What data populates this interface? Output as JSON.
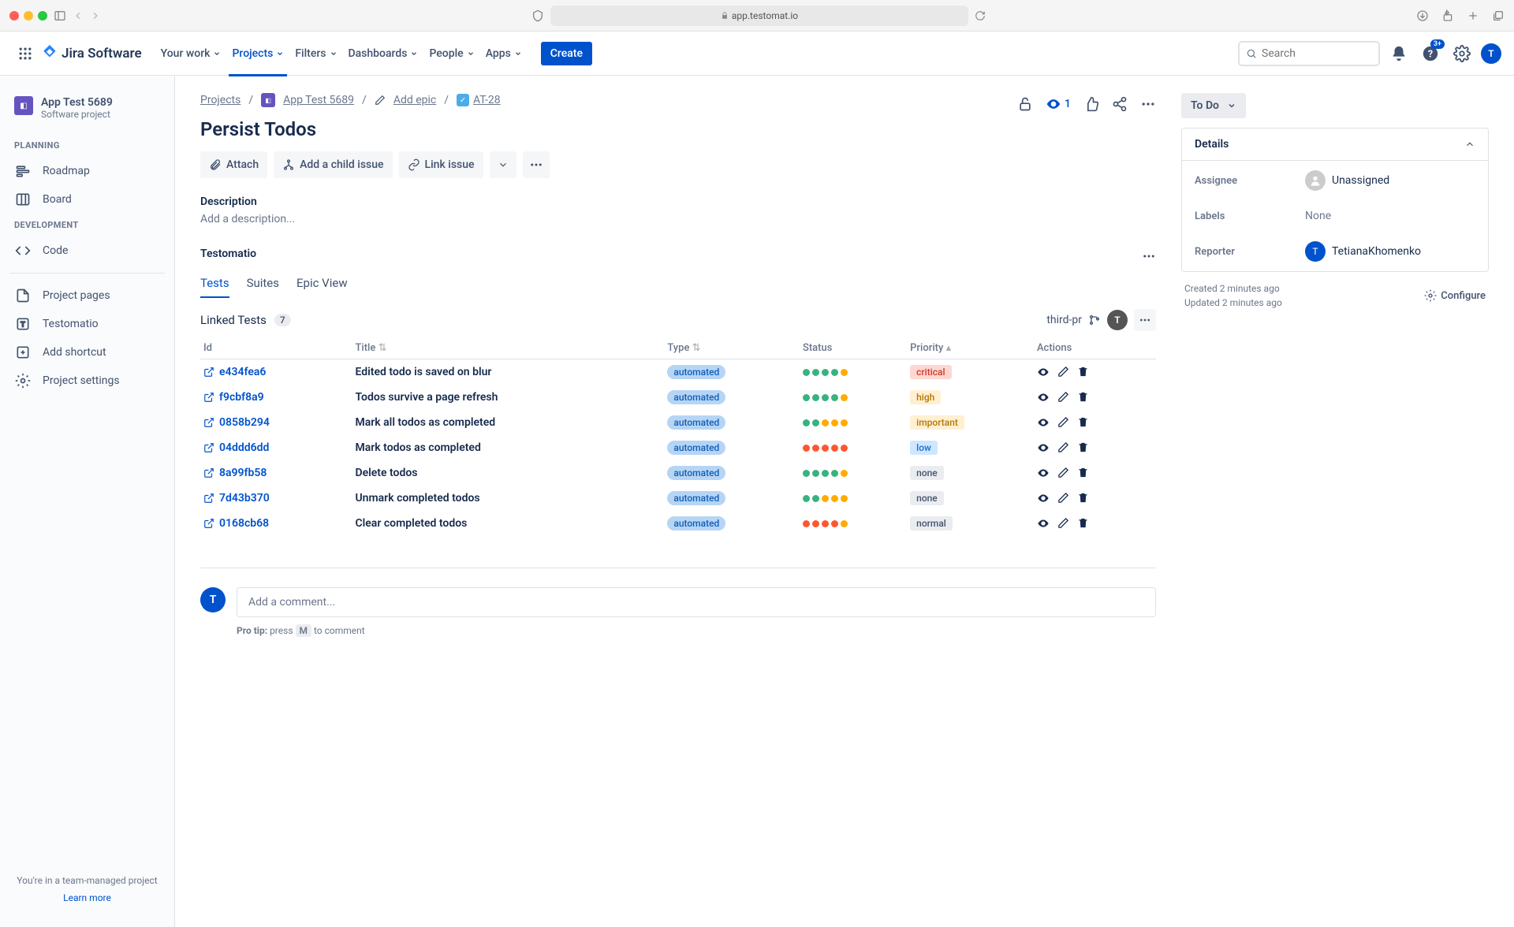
{
  "browser": {
    "url": "app.testomat.io"
  },
  "topnav": {
    "logo": "Jira Software",
    "items": [
      "Your work",
      "Projects",
      "Filters",
      "Dashboards",
      "People",
      "Apps"
    ],
    "active_index": 1,
    "create": "Create",
    "search_placeholder": "Search",
    "badge": "3+",
    "avatar_initial": "T"
  },
  "sidebar": {
    "project_name": "App Test 5689",
    "project_type": "Software project",
    "section_planning": "PLANNING",
    "section_dev": "DEVELOPMENT",
    "items_planning": [
      "Roadmap",
      "Board"
    ],
    "items_dev": [
      "Code"
    ],
    "items_bottom": [
      "Project pages",
      "Testomatio",
      "Add shortcut",
      "Project settings"
    ],
    "footer": "You're in a team-managed project",
    "footer_link": "Learn more"
  },
  "breadcrumb": {
    "projects": "Projects",
    "project": "App Test 5689",
    "add_epic": "Add epic",
    "issue_key": "AT-28"
  },
  "issue": {
    "title": "Persist Todos",
    "watchers": "1",
    "actions": {
      "attach": "Attach",
      "add_child": "Add a child issue",
      "link": "Link issue"
    },
    "description_label": "Description",
    "description_placeholder": "Add a description..."
  },
  "testomatio": {
    "panel_title": "Testomatio",
    "tabs": [
      "Tests",
      "Suites",
      "Epic View"
    ],
    "active_tab": 0,
    "linked_label": "Linked Tests",
    "count": "7",
    "project_label": "third-pr",
    "avatar": "T",
    "columns": {
      "id": "Id",
      "title": "Title",
      "type": "Type",
      "status": "Status",
      "priority": "Priority",
      "actions": "Actions"
    },
    "rows": [
      {
        "id": "e434fea6",
        "title": "Edited todo is saved on blur",
        "type": "automated",
        "status": [
          "g",
          "g",
          "g",
          "g",
          "y"
        ],
        "priority": "critical"
      },
      {
        "id": "f9cbf8a9",
        "title": "Todos survive a page refresh",
        "type": "automated",
        "status": [
          "g",
          "g",
          "g",
          "g",
          "y"
        ],
        "priority": "high"
      },
      {
        "id": "0858b294",
        "title": "Mark all todos as completed",
        "type": "automated",
        "status": [
          "g",
          "g",
          "y",
          "y",
          "y"
        ],
        "priority": "important"
      },
      {
        "id": "04ddd6dd",
        "title": "Mark todos as completed",
        "type": "automated",
        "status": [
          "r",
          "r",
          "r",
          "r",
          "r"
        ],
        "priority": "low"
      },
      {
        "id": "8a99fb58",
        "title": "Delete todos",
        "type": "automated",
        "status": [
          "g",
          "g",
          "g",
          "g",
          "y"
        ],
        "priority": "none"
      },
      {
        "id": "7d43b370",
        "title": "Unmark completed todos",
        "type": "automated",
        "status": [
          "g",
          "g",
          "y",
          "y",
          "y"
        ],
        "priority": "none"
      },
      {
        "id": "0168cb68",
        "title": "Clear completed todos",
        "type": "automated",
        "status": [
          "r",
          "r",
          "r",
          "r",
          "y"
        ],
        "priority": "normal"
      }
    ]
  },
  "comment": {
    "placeholder": "Add a comment...",
    "tip_label": "Pro tip:",
    "tip_press": "press",
    "tip_key": "M",
    "tip_rest": "to comment",
    "avatar": "T"
  },
  "details": {
    "status": "To Do",
    "header": "Details",
    "assignee_label": "Assignee",
    "assignee_value": "Unassigned",
    "labels_label": "Labels",
    "labels_value": "None",
    "reporter_label": "Reporter",
    "reporter_value": "TetianaKhomenko",
    "reporter_initial": "T",
    "created": "Created 2 minutes ago",
    "updated": "Updated 2 minutes ago",
    "configure": "Configure"
  }
}
